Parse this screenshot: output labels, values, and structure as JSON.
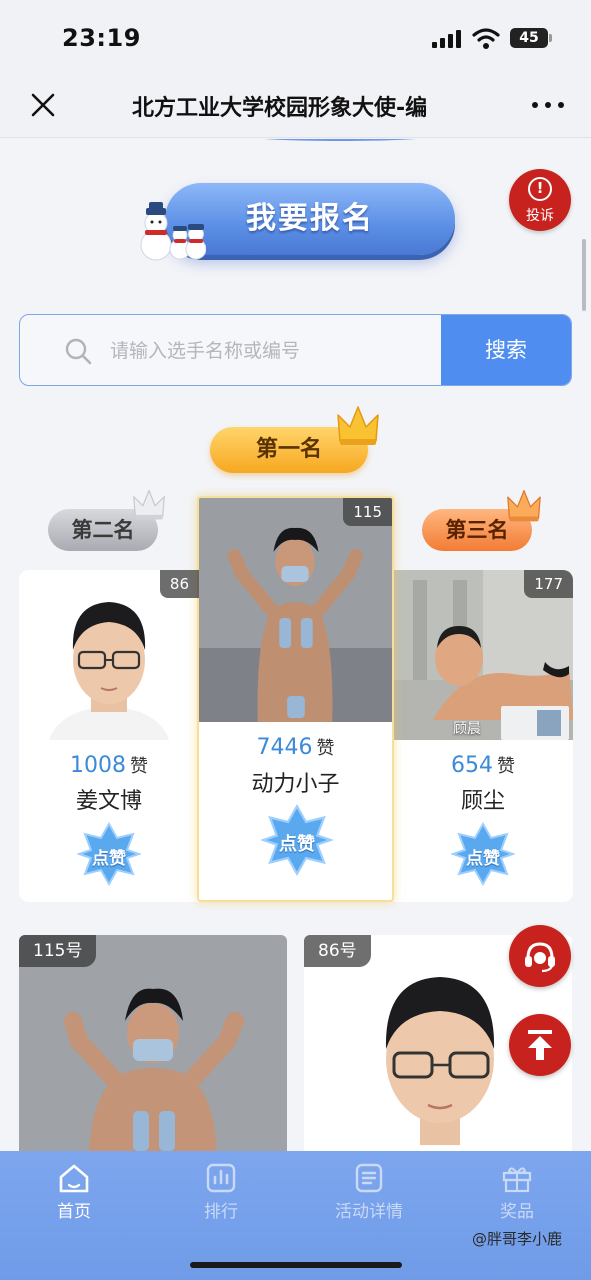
{
  "status_bar": {
    "time": "23:19",
    "battery": "45"
  },
  "nav": {
    "title": "北方工业大学校园形象大使-编"
  },
  "actions": {
    "signup_label": "我要报名",
    "report_label": "投诉"
  },
  "search": {
    "placeholder": "请输入选手名称或编号",
    "value": "",
    "button_label": "搜索"
  },
  "podium": {
    "first": {
      "rank_label": "第一名",
      "count": "115",
      "votes": "7446",
      "vote_unit": "赞",
      "name": "动力小子",
      "like_label": "点赞"
    },
    "second": {
      "rank_label": "第二名",
      "count": "86",
      "votes": "1008",
      "vote_unit": "赞",
      "name": "姜文博",
      "like_label": "点赞"
    },
    "third": {
      "rank_label": "第三名",
      "count": "177",
      "votes": "654",
      "vote_unit": "赞",
      "name": "顾尘",
      "like_label": "点赞",
      "photo_caption": "顾晨"
    }
  },
  "contestants": [
    {
      "number_label": "115号"
    },
    {
      "number_label": "86号"
    }
  ],
  "tabs": [
    {
      "label": "首页",
      "icon": "home-icon",
      "active": true
    },
    {
      "label": "排行",
      "icon": "ranking-icon",
      "active": false
    },
    {
      "label": "活动详情",
      "icon": "details-icon",
      "active": false
    },
    {
      "label": "奖品",
      "icon": "gift-icon",
      "active": false
    }
  ],
  "watermark": "@胖哥李小鹿",
  "colors": {
    "accent_blue": "#4f8ef0",
    "tabbar_blue": "#7da6ee",
    "action_red": "#c8221e",
    "gold": "#f7a820",
    "vote_blue": "#3d8ad8"
  }
}
